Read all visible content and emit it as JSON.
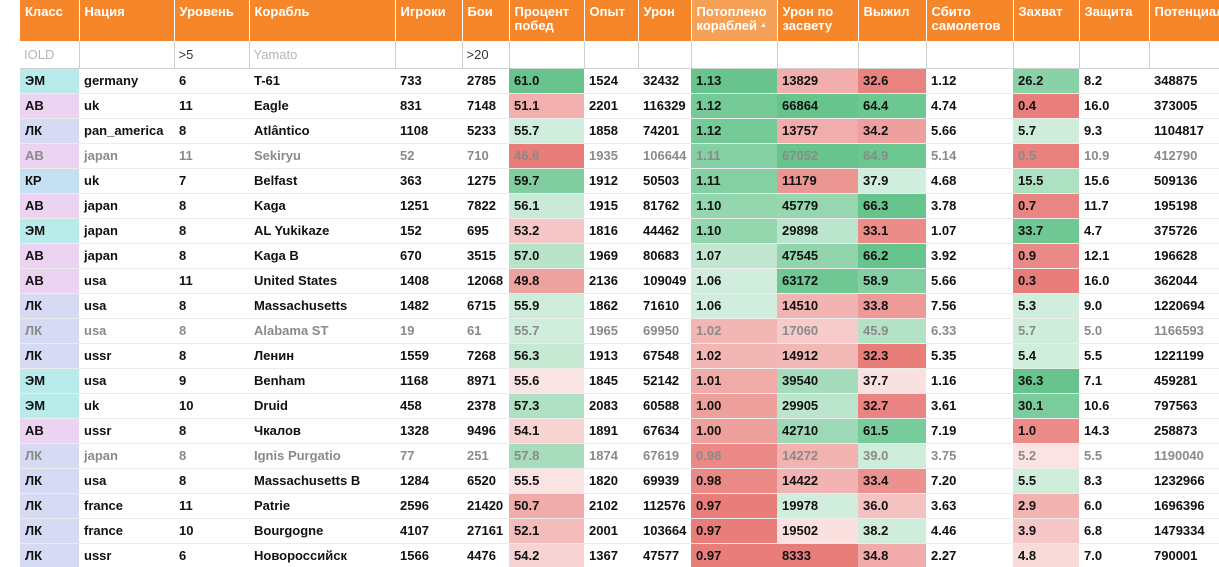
{
  "columns": [
    {
      "key": "class",
      "label": "Класс",
      "filter": "",
      "placeholder": "IOLD"
    },
    {
      "key": "nation",
      "label": "Нация",
      "filter": "",
      "placeholder": ""
    },
    {
      "key": "tier",
      "label": "Уровень",
      "filter": ">5",
      "placeholder": ""
    },
    {
      "key": "ship",
      "label": "Корабль",
      "filter": "",
      "placeholder": "Yamato"
    },
    {
      "key": "players",
      "label": "Игроки",
      "filter": "",
      "placeholder": ""
    },
    {
      "key": "battles",
      "label": "Бои",
      "filter": ">20",
      "placeholder": ""
    },
    {
      "key": "winrate",
      "label": "Процент побед",
      "filter": "",
      "placeholder": ""
    },
    {
      "key": "xp",
      "label": "Опыт",
      "filter": "",
      "placeholder": ""
    },
    {
      "key": "damage",
      "label": "Урон",
      "filter": "",
      "placeholder": ""
    },
    {
      "key": "kills",
      "label": "Потоплено кораблей",
      "filter": "",
      "placeholder": "",
      "sorted": "desc"
    },
    {
      "key": "spot_damage",
      "label": "Урон по засвету",
      "filter": "",
      "placeholder": ""
    },
    {
      "key": "survived",
      "label": "Выжил",
      "filter": "",
      "placeholder": ""
    },
    {
      "key": "planes",
      "label": "Сбито самолетов",
      "filter": "",
      "placeholder": ""
    },
    {
      "key": "capture",
      "label": "Захват",
      "filter": "",
      "placeholder": ""
    },
    {
      "key": "defense",
      "label": "Защита",
      "filter": "",
      "placeholder": ""
    },
    {
      "key": "potential",
      "label": "Потенциальный урон",
      "filter": "",
      "placeholder": ""
    }
  ],
  "rows": [
    {
      "dim": false,
      "cells": [
        "ЭМ",
        "germany",
        "6",
        "T-61",
        "733",
        "2785",
        "61.0",
        "1524",
        "32432",
        "1.13",
        "13829",
        "32.6",
        "1.12",
        "26.2",
        "8.2",
        "348875"
      ]
    },
    {
      "dim": false,
      "cells": [
        "АВ",
        "uk",
        "11",
        "Eagle",
        "831",
        "7148",
        "51.1",
        "2201",
        "116329",
        "1.12",
        "66864",
        "64.4",
        "4.74",
        "0.4",
        "16.0",
        "373005"
      ]
    },
    {
      "dim": false,
      "cells": [
        "ЛК",
        "pan_america",
        "8",
        "Atlântico",
        "1108",
        "5233",
        "55.7",
        "1858",
        "74201",
        "1.12",
        "13757",
        "34.2",
        "5.66",
        "5.7",
        "9.3",
        "1104817"
      ]
    },
    {
      "dim": true,
      "cells": [
        "АВ",
        "japan",
        "11",
        "Sekiryu",
        "52",
        "710",
        "46.6",
        "1935",
        "106644",
        "1.11",
        "67052",
        "64.9",
        "5.14",
        "0.5",
        "10.9",
        "412790"
      ]
    },
    {
      "dim": false,
      "cells": [
        "КР",
        "uk",
        "7",
        "Belfast",
        "363",
        "1275",
        "59.7",
        "1912",
        "50503",
        "1.11",
        "11179",
        "37.9",
        "4.68",
        "15.5",
        "15.6",
        "509136"
      ]
    },
    {
      "dim": false,
      "cells": [
        "АВ",
        "japan",
        "8",
        "Kaga",
        "1251",
        "7822",
        "56.1",
        "1915",
        "81762",
        "1.10",
        "45779",
        "66.3",
        "3.78",
        "0.7",
        "11.7",
        "195198"
      ]
    },
    {
      "dim": false,
      "cells": [
        "ЭМ",
        "japan",
        "8",
        "AL Yukikaze",
        "152",
        "695",
        "53.2",
        "1816",
        "44462",
        "1.10",
        "29898",
        "33.1",
        "1.07",
        "33.7",
        "4.7",
        "375726"
      ]
    },
    {
      "dim": false,
      "cells": [
        "АВ",
        "japan",
        "8",
        "Kaga B",
        "670",
        "3515",
        "57.0",
        "1969",
        "80683",
        "1.07",
        "47545",
        "66.2",
        "3.92",
        "0.9",
        "12.1",
        "196628"
      ]
    },
    {
      "dim": false,
      "cells": [
        "АВ",
        "usa",
        "11",
        "United States",
        "1408",
        "12068",
        "49.8",
        "2136",
        "109049",
        "1.06",
        "63172",
        "58.9",
        "5.66",
        "0.3",
        "16.0",
        "362044"
      ]
    },
    {
      "dim": false,
      "cells": [
        "ЛК",
        "usa",
        "8",
        "Massachusetts",
        "1482",
        "6715",
        "55.9",
        "1862",
        "71610",
        "1.06",
        "14510",
        "33.8",
        "7.56",
        "5.3",
        "9.0",
        "1220694"
      ]
    },
    {
      "dim": true,
      "cells": [
        "ЛК",
        "usa",
        "8",
        "Alabama ST",
        "19",
        "61",
        "55.7",
        "1965",
        "69950",
        "1.02",
        "17060",
        "45.9",
        "6.33",
        "5.7",
        "5.0",
        "1166593"
      ]
    },
    {
      "dim": false,
      "cells": [
        "ЛК",
        "ussr",
        "8",
        "Ленин",
        "1559",
        "7268",
        "56.3",
        "1913",
        "67548",
        "1.02",
        "14912",
        "32.3",
        "5.35",
        "5.4",
        "5.5",
        "1221199"
      ]
    },
    {
      "dim": false,
      "cells": [
        "ЭМ",
        "usa",
        "9",
        "Benham",
        "1168",
        "8971",
        "55.6",
        "1845",
        "52142",
        "1.01",
        "39540",
        "37.7",
        "1.16",
        "36.3",
        "7.1",
        "459281"
      ]
    },
    {
      "dim": false,
      "cells": [
        "ЭМ",
        "uk",
        "10",
        "Druid",
        "458",
        "2378",
        "57.3",
        "2083",
        "60588",
        "1.00",
        "29905",
        "32.7",
        "3.61",
        "30.1",
        "10.6",
        "797563"
      ]
    },
    {
      "dim": false,
      "cells": [
        "АВ",
        "ussr",
        "8",
        "Чкалов",
        "1328",
        "9496",
        "54.1",
        "1891",
        "67634",
        "1.00",
        "42710",
        "61.5",
        "7.19",
        "1.0",
        "14.3",
        "258873"
      ]
    },
    {
      "dim": true,
      "cells": [
        "ЛК",
        "japan",
        "8",
        "Ignis Purgatio",
        "77",
        "251",
        "57.8",
        "1874",
        "67619",
        "0.98",
        "14272",
        "39.0",
        "3.75",
        "5.2",
        "5.5",
        "1190040"
      ]
    },
    {
      "dim": false,
      "cells": [
        "ЛК",
        "usa",
        "8",
        "Massachusetts B",
        "1284",
        "6520",
        "55.5",
        "1820",
        "69939",
        "0.98",
        "14422",
        "33.4",
        "7.20",
        "5.5",
        "8.3",
        "1232966"
      ]
    },
    {
      "dim": false,
      "cells": [
        "ЛК",
        "france",
        "11",
        "Patrie",
        "2596",
        "21420",
        "50.7",
        "2102",
        "112576",
        "0.97",
        "19978",
        "36.0",
        "3.63",
        "2.9",
        "6.0",
        "1696396"
      ]
    },
    {
      "dim": false,
      "cells": [
        "ЛК",
        "france",
        "10",
        "Bourgogne",
        "4107",
        "27161",
        "52.1",
        "2001",
        "103664",
        "0.97",
        "19502",
        "38.2",
        "4.46",
        "3.9",
        "6.8",
        "1479334"
      ]
    },
    {
      "dim": false,
      "cells": [
        "ЛК",
        "ussr",
        "6",
        "Новороссийск",
        "1566",
        "4476",
        "54.2",
        "1367",
        "47577",
        "0.97",
        "8333",
        "34.8",
        "2.27",
        "4.8",
        "7.0",
        "790001"
      ]
    }
  ],
  "colors": {
    "header": "#f5862a",
    "header_sorted": "#f6a055",
    "class_ЭМ": "#b8ebe9",
    "class_АВ": "#ecd3f2",
    "class_ЛК": "#d6daf3",
    "class_КР": "#c6e0f3",
    "good": [
      102,
      196,
      140
    ],
    "bad": [
      232,
      125,
      122
    ]
  },
  "colored_columns": [
    "winrate",
    "kills",
    "spot_damage",
    "survived",
    "capture"
  ]
}
